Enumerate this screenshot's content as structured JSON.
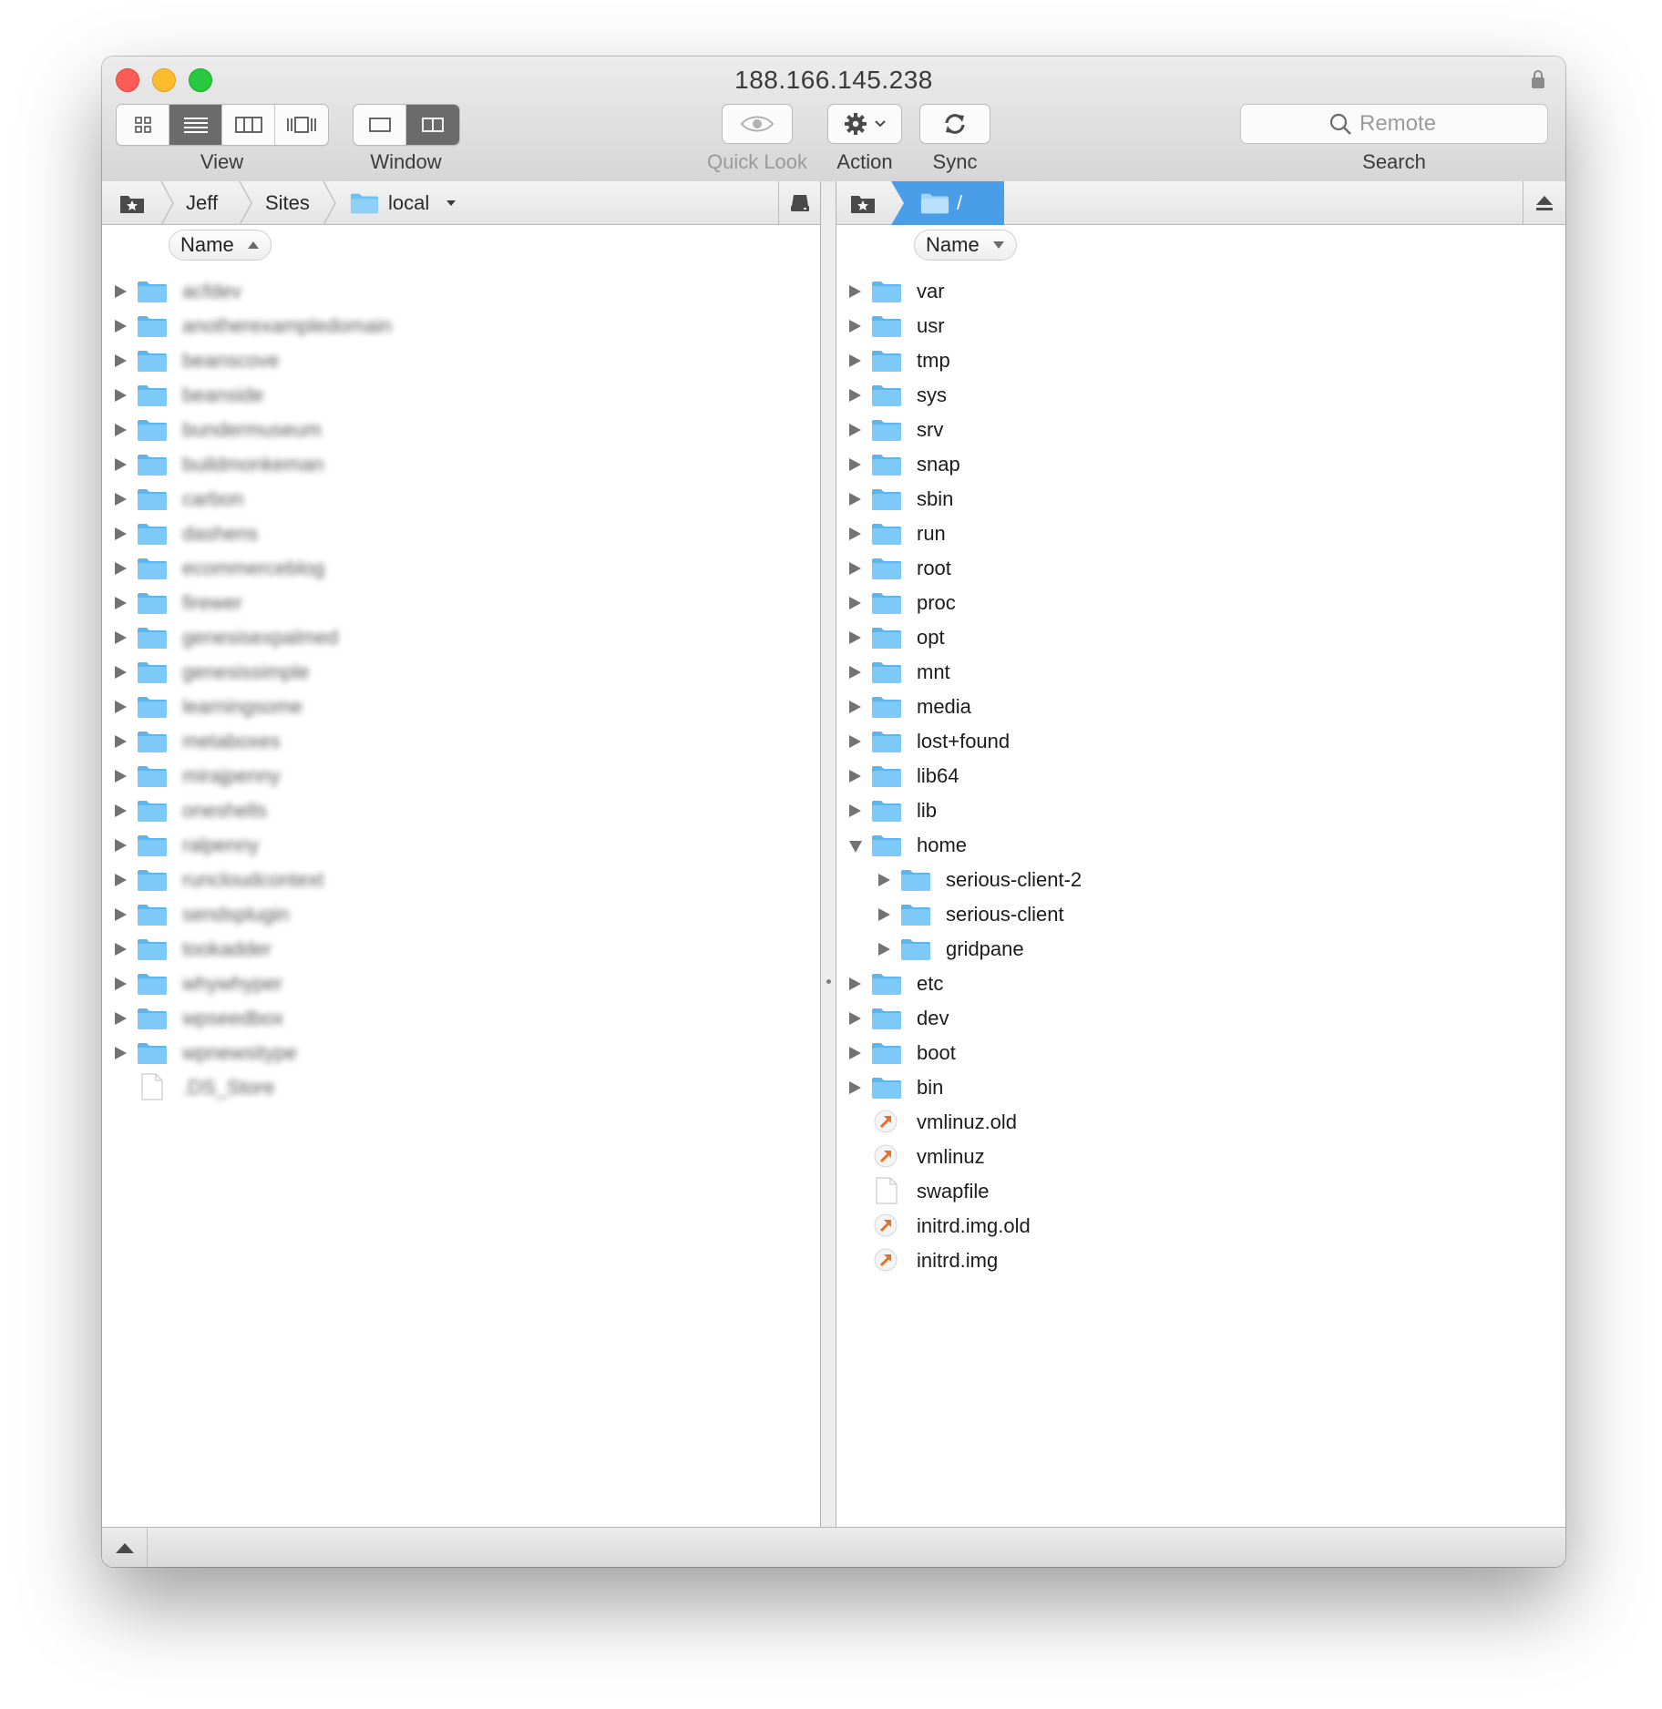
{
  "window": {
    "title": "188.166.145.238"
  },
  "toolbar": {
    "view_label": "View",
    "window_label": "Window",
    "quicklook_label": "Quick Look",
    "action_label": "Action",
    "sync_label": "Sync",
    "search_label": "Search",
    "search_placeholder": "Remote"
  },
  "left": {
    "crumbs": [
      "Jeff",
      "Sites",
      "local"
    ],
    "column_header": "Name",
    "sort": "ascending",
    "items": [
      {
        "type": "folder",
        "name": "acfdev"
      },
      {
        "type": "folder",
        "name": "anotherexampledomain"
      },
      {
        "type": "folder",
        "name": "beanscove"
      },
      {
        "type": "folder",
        "name": "beanside"
      },
      {
        "type": "folder",
        "name": "bundermuseum"
      },
      {
        "type": "folder",
        "name": "buildmonkeman"
      },
      {
        "type": "folder",
        "name": "carbon"
      },
      {
        "type": "folder",
        "name": "dashens"
      },
      {
        "type": "folder",
        "name": "ecommerceblog"
      },
      {
        "type": "folder",
        "name": "firewer"
      },
      {
        "type": "folder",
        "name": "genesisexpalmed"
      },
      {
        "type": "folder",
        "name": "genesissimple"
      },
      {
        "type": "folder",
        "name": "learningsome"
      },
      {
        "type": "folder",
        "name": "metaboxes"
      },
      {
        "type": "folder",
        "name": "mirajpenny"
      },
      {
        "type": "folder",
        "name": "oneshells"
      },
      {
        "type": "folder",
        "name": "ralpenny"
      },
      {
        "type": "folder",
        "name": "runcloudcontext"
      },
      {
        "type": "folder",
        "name": "sendsplugin"
      },
      {
        "type": "folder",
        "name": "tookadder"
      },
      {
        "type": "folder",
        "name": "whywhyper"
      },
      {
        "type": "folder",
        "name": "wpseedbox"
      },
      {
        "type": "folder",
        "name": "wpnewsitype"
      },
      {
        "type": "file",
        "name": ".DS_Store"
      }
    ]
  },
  "right": {
    "path": "/",
    "column_header": "Name",
    "sort": "descending",
    "items": [
      {
        "type": "folder",
        "name": "var",
        "depth": 0
      },
      {
        "type": "folder",
        "name": "usr",
        "depth": 0
      },
      {
        "type": "folder",
        "name": "tmp",
        "depth": 0
      },
      {
        "type": "folder",
        "name": "sys",
        "depth": 0
      },
      {
        "type": "folder",
        "name": "srv",
        "depth": 0
      },
      {
        "type": "folder",
        "name": "snap",
        "depth": 0
      },
      {
        "type": "folder",
        "name": "sbin",
        "depth": 0
      },
      {
        "type": "folder",
        "name": "run",
        "depth": 0
      },
      {
        "type": "folder",
        "name": "root",
        "depth": 0
      },
      {
        "type": "folder",
        "name": "proc",
        "depth": 0
      },
      {
        "type": "folder",
        "name": "opt",
        "depth": 0
      },
      {
        "type": "folder",
        "name": "mnt",
        "depth": 0
      },
      {
        "type": "folder",
        "name": "media",
        "depth": 0
      },
      {
        "type": "folder",
        "name": "lost+found",
        "depth": 0
      },
      {
        "type": "folder",
        "name": "lib64",
        "depth": 0
      },
      {
        "type": "folder",
        "name": "lib",
        "depth": 0
      },
      {
        "type": "folder",
        "name": "home",
        "depth": 0,
        "expanded": true
      },
      {
        "type": "folder",
        "name": "serious-client-2",
        "depth": 1
      },
      {
        "type": "folder",
        "name": "serious-client",
        "depth": 1
      },
      {
        "type": "folder",
        "name": "gridpane",
        "depth": 1
      },
      {
        "type": "folder",
        "name": "etc",
        "depth": 0
      },
      {
        "type": "folder",
        "name": "dev",
        "depth": 0
      },
      {
        "type": "folder",
        "name": "boot",
        "depth": 0
      },
      {
        "type": "folder",
        "name": "bin",
        "depth": 0
      },
      {
        "type": "alias",
        "name": "vmlinuz.old",
        "depth": 0
      },
      {
        "type": "alias",
        "name": "vmlinuz",
        "depth": 0
      },
      {
        "type": "file",
        "name": "swapfile",
        "depth": 0
      },
      {
        "type": "alias",
        "name": "initrd.img.old",
        "depth": 0
      },
      {
        "type": "alias",
        "name": "initrd.img",
        "depth": 0
      }
    ]
  },
  "colors": {
    "folder": "#6cc1f5",
    "alias_arrow": "#e8701f",
    "path_active": "#4a9ee8"
  }
}
